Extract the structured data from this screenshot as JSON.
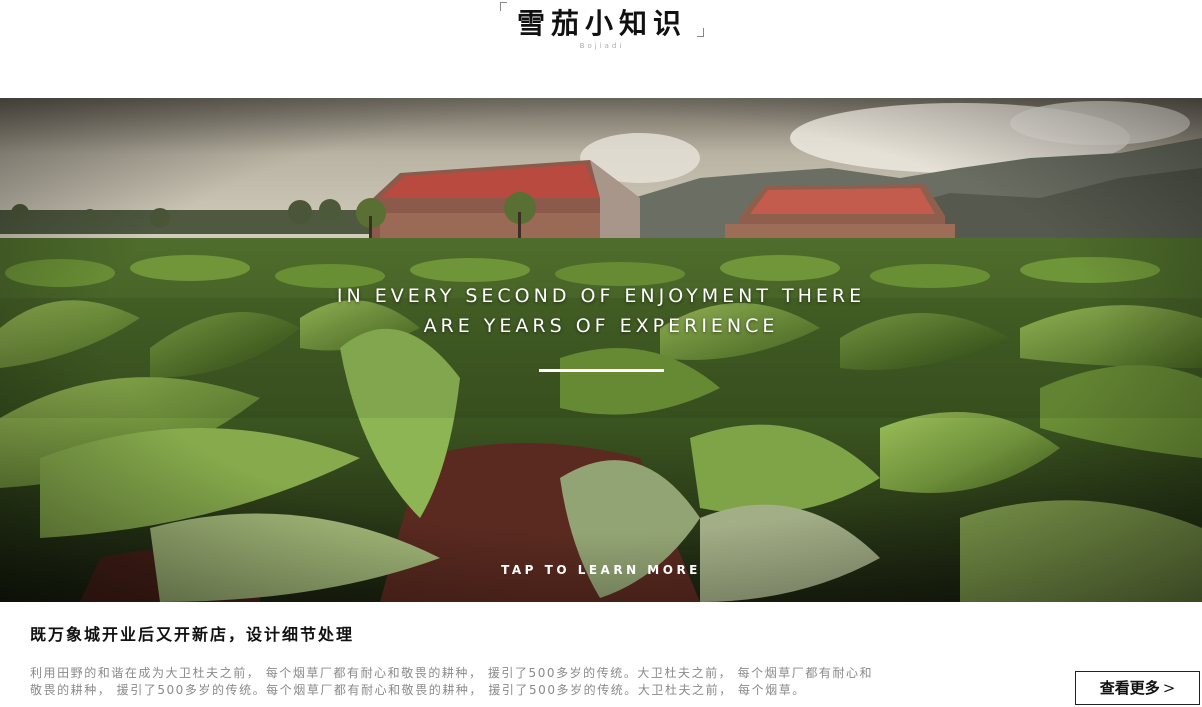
{
  "header": {
    "brand_title": "雪茄小知识",
    "brand_subtitle": "Bojiadi"
  },
  "hero": {
    "quote_line1": "IN EVERY SECOND OF ENJOYMENT THERE",
    "quote_line2": "ARE YEARS OF EXPERIENCE",
    "cta_label": "TAP TO LEARN MORE"
  },
  "article": {
    "title": "既万象城开业后又开新店，设计细节处理",
    "body_line1": "利用田野的和谐在成为大卫杜夫之前， 每个烟草厂都有耐心和敬畏的耕种， 援引了500多岁的传统。大卫杜夫之前， 每个烟草厂都有耐心和",
    "body_line2": "敬畏的耕种， 援引了500多岁的传统。每个烟草厂都有耐心和敬畏的耕种， 援引了500多岁的传统。大卫杜夫之前， 每个烟草。",
    "more_label": "查看更多",
    "more_arrow": ">"
  }
}
